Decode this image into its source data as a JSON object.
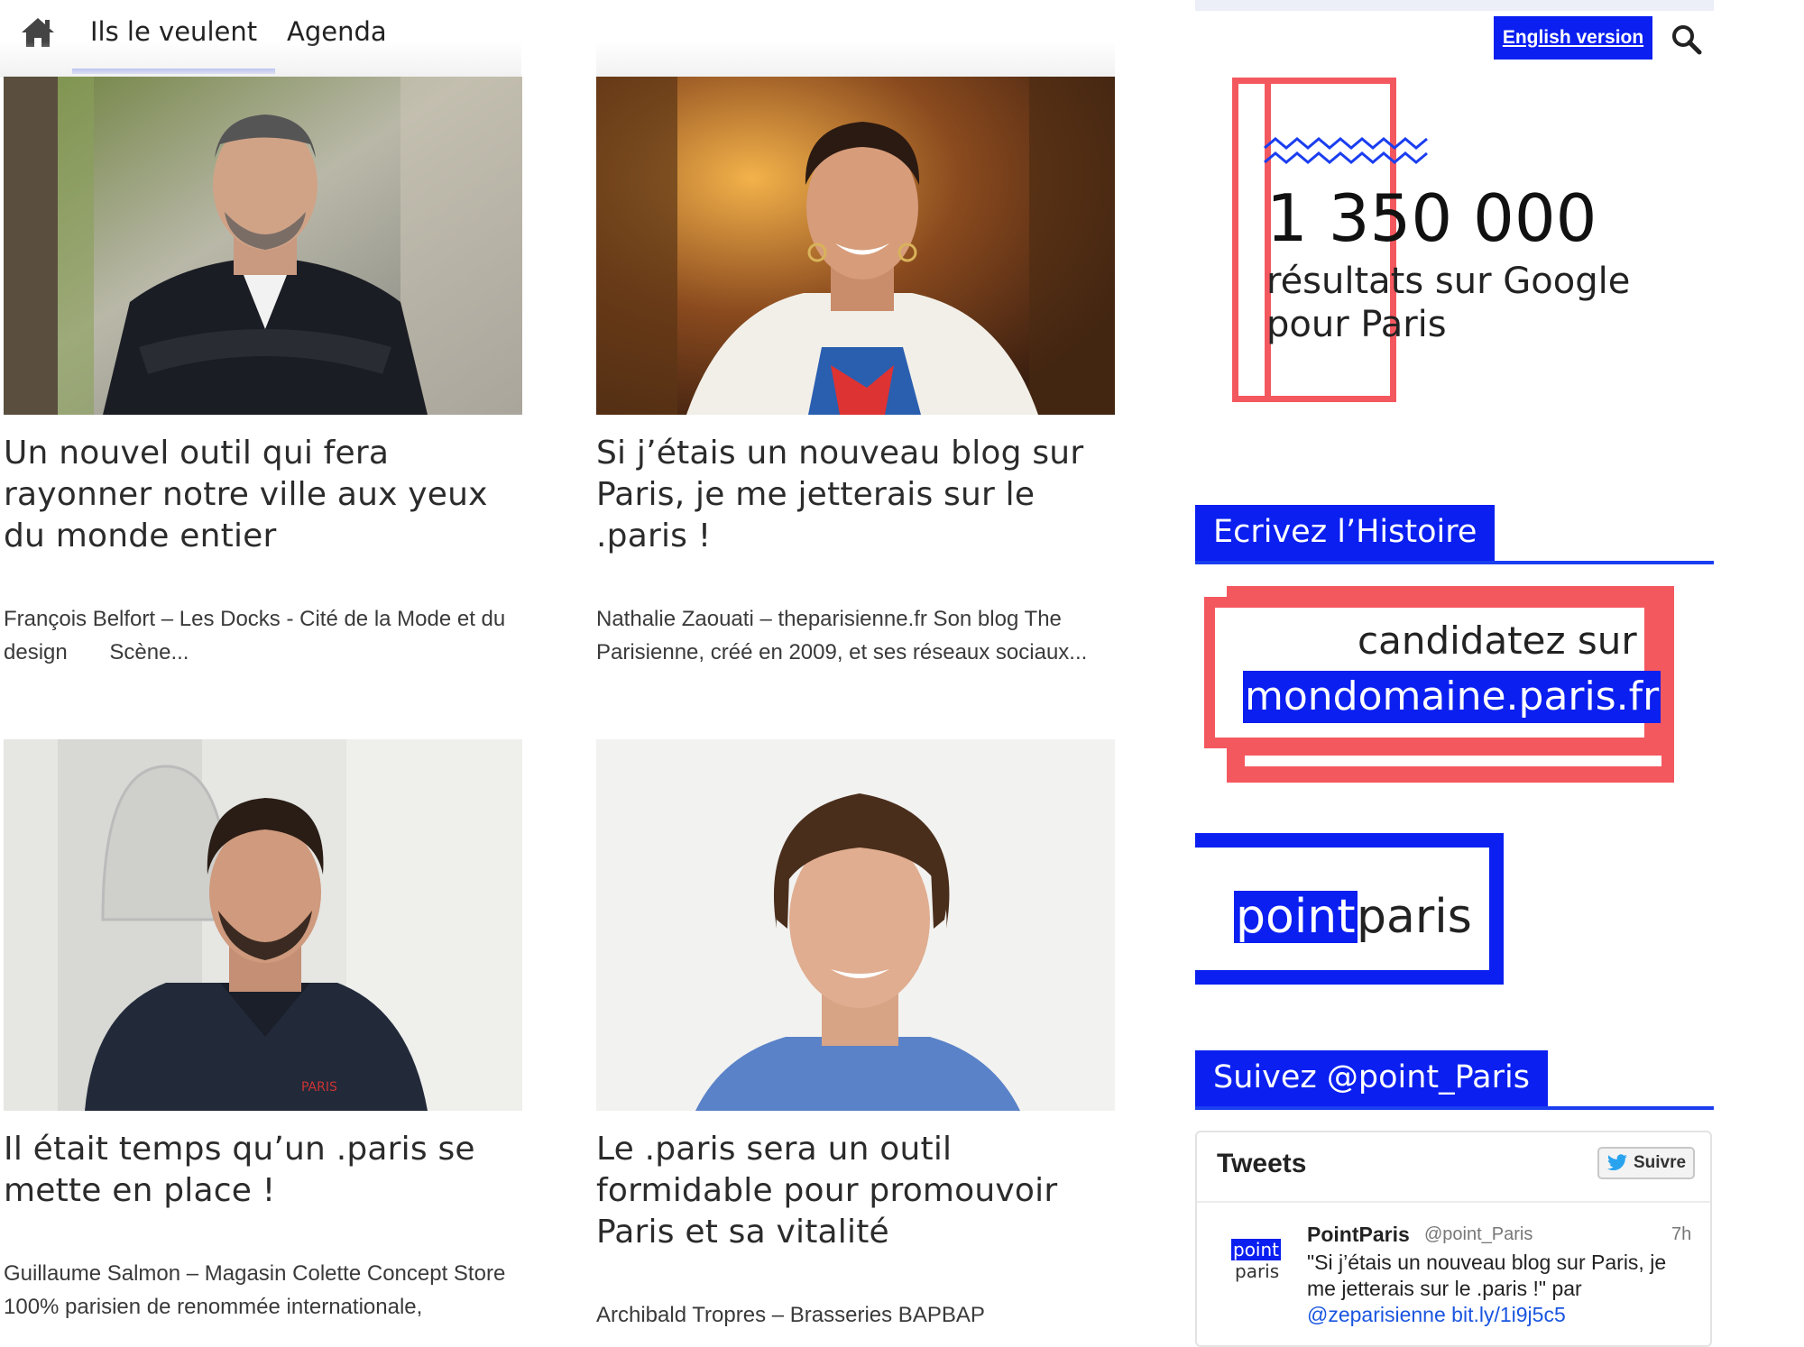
{
  "nav": {
    "items": [
      {
        "label": "Ils le veulent",
        "active": true
      },
      {
        "label": "Agenda",
        "active": false
      }
    ],
    "english_label": "English version"
  },
  "articles": [
    {
      "title": "Un nouvel outil qui fera rayonner notre ville aux yeux du monde entier",
      "excerpt": "François Belfort – Les Docks - Cité de la Mode et du design       Scène..."
    },
    {
      "title": "Si j’étais un nouveau blog sur Paris, je me jetterais sur le .paris !",
      "excerpt": "Nathalie Zaouati – theparisienne.fr Son blog The Parisienne, créé en 2009, et ses réseaux sociaux..."
    },
    {
      "title": "Il était temps qu’un .paris se mette en place !",
      "excerpt": "Guillaume Salmon – Magasin Colette Concept Store 100% parisien de renommée internationale,"
    },
    {
      "title": "Le .paris sera un outil formidable pour promouvoir Paris et sa vitalité",
      "excerpt": "Archibald Tropres – Brasseries BAPBAP"
    }
  ],
  "sidebar": {
    "stat_number": "1 350 000",
    "stat_line1": "résultats sur Google",
    "stat_line2": "pour Paris",
    "history_heading": "Ecrivez l’Histoire",
    "candidate_line1": "candidatez sur",
    "candidate_line2": "mondomaine.paris.fr",
    "logo_blue": "point",
    "logo_rest": "paris",
    "follow_heading": "Suivez @point_Paris",
    "tweets": {
      "title": "Tweets",
      "follow_label": "Suivre",
      "avatar_blue": "point",
      "avatar_grey": "paris",
      "name": "PointParis",
      "handle": "@point_Paris",
      "time": "7h",
      "text": "\"Si j’étais un nouveau blog sur Paris, je me jetterais sur le .paris !\" par",
      "mention": "@zeparisienne",
      "link": "bit.ly/1i9j5c5"
    }
  },
  "colors": {
    "accent_blue": "#0a1ff0",
    "coral": "#f4585f"
  }
}
